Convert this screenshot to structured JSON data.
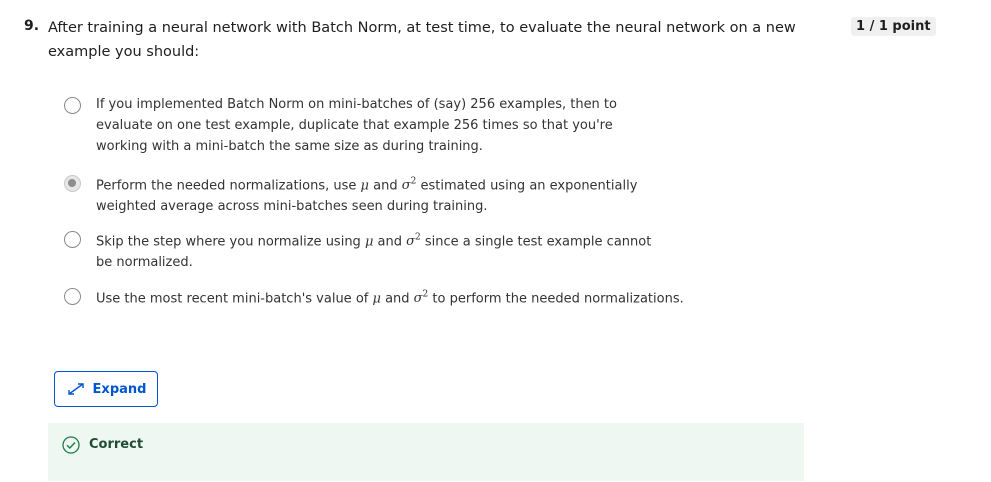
{
  "question": {
    "number": "9.",
    "text": "After training a neural network with Batch Norm, at test time, to evaluate the neural network on a new example you should:",
    "score": "1 / 1 point"
  },
  "options": [
    {
      "text": "If you implemented Batch Norm on mini-batches of (say) 256 examples, then to evaluate on one test example, duplicate that example 256 times so that you're working with a mini-batch the same size as during training.",
      "selected": false
    },
    {
      "pre": "Perform the needed normalizations, use ",
      "mu": "μ",
      "and": " and ",
      "sigma": "σ",
      "sup": "2",
      "post": " estimated using an exponentially weighted average across mini-batches seen during training.",
      "selected": true
    },
    {
      "pre": "Skip the step where you normalize using ",
      "mu": "μ",
      "and": " and ",
      "sigma": "σ",
      "sup": "2",
      "post": " since a single test example cannot be normalized.",
      "selected": false
    },
    {
      "pre": "Use the most recent mini-batch's value of ",
      "mu": "μ",
      "and": " and ",
      "sigma": "σ",
      "sup": "2",
      "post": " to perform the needed normalizations.",
      "selected": false
    }
  ],
  "expand": {
    "label": "Expand",
    "icon": "expand-arrows-icon"
  },
  "feedback": {
    "label": "Correct",
    "icon": "check-circle-icon",
    "color": "#1e7d45"
  }
}
